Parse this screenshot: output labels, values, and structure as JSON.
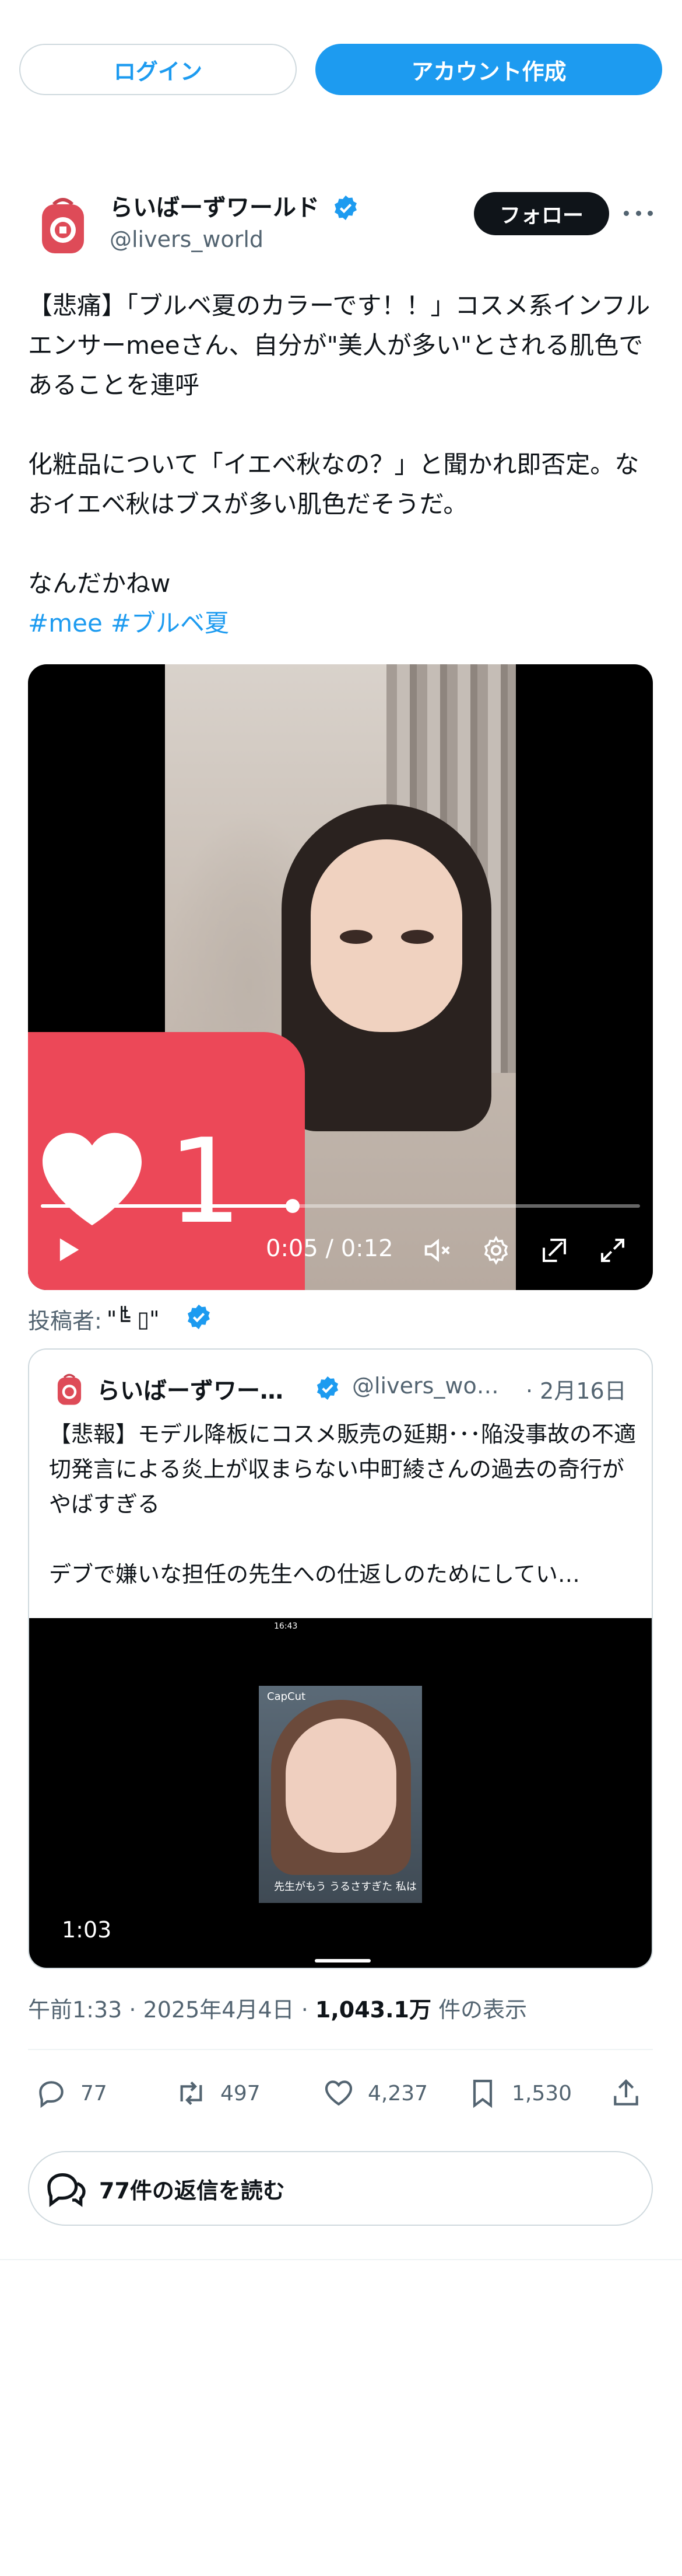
{
  "auth": {
    "login_label": "ログイン",
    "signup_label": "アカウント作成"
  },
  "tweet": {
    "display_name": "らいばーずワールド",
    "handle": "@livers_world",
    "follow_label": "フォロー",
    "text": "【悲痛】「ブルベ夏のカラーです！！」コスメ系インフルエンサーmeeさん、自分が\"美人が多い\"とされる肌色であることを連呼\n\n化粧品について「イエベ秋なの？」と聞かれ即否定。なおイエベ秋はブスが多い肌色だそうだ。\n\nなんだかねw",
    "hashtags": [
      "#mee",
      "#ブルベ夏"
    ],
    "video": {
      "heart_count": "1",
      "time": "0:05 / 0:12",
      "progress": 0.42
    },
    "posted_by_label": "投稿者:",
    "posted_by_glyphs": "\"╚̄ ▯\""
  },
  "quote": {
    "display_name": "らいばーずワー…",
    "handle": "@livers_wo…",
    "date": "· 2月16日",
    "text": "【悲報】モデル降板にコスメ販売の延期･･･陥没事故の不適切発言による炎上が収まらない中町綾さんの過去の奇行がやばすぎる\n\nデブで嫌いな担任の先生への仕返しのためにしてい…",
    "media_status": "16:43",
    "media_app": "CapCut",
    "media_subtitle": "先生がもう うるさすぎた 私は",
    "duration": "1:03"
  },
  "meta": {
    "time": "午前1:33",
    "sep1": " · ",
    "date": "2025年4月4日",
    "sep2": " · ",
    "views": "1,043.1万",
    "views_suffix": " 件の表示"
  },
  "actions": {
    "replies": "77",
    "retweets": "497",
    "likes": "4,237",
    "bookmarks": "1,530"
  },
  "read_replies_label": "77件の返信を読む",
  "colors": {
    "accent": "#1d9bf0",
    "heart_card": "#ec4858",
    "follow_bg": "#0f1419"
  }
}
